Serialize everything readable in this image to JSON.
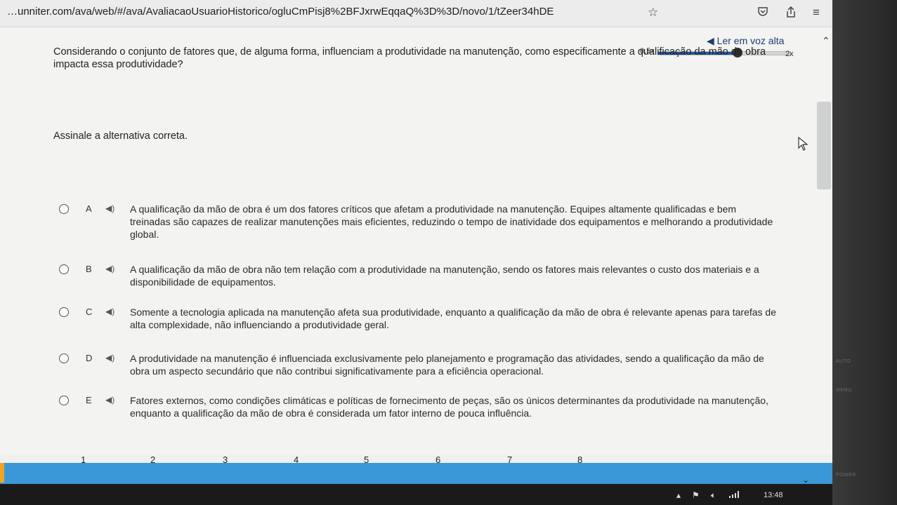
{
  "browser": {
    "url": "…unniter.com/ava/web/#/ava/AvaliacaoUsuarioHistorico/ogluCmPisj8%2BFJxrwEqqaQ%3D%3D/novo/1/tZeer34hDE",
    "star_icon": "star-icon",
    "pocket_icon": "pocket-icon",
    "share_icon": "share-icon",
    "menu_icon": "menu-icon"
  },
  "reader": {
    "label": "◀︎ Ler em voz alta",
    "speed_min": "0,5x",
    "speed_max": "2x",
    "speed_level": 0.6,
    "collapse_icon": "chevron-up-icon",
    "accent_color": "#1f5aa8"
  },
  "question": {
    "text": "Considerando o conjunto de fatores que, de alguma forma, influenciam a produtividade na manutenção, como especificamente a qualificação da mão de obra impacta essa produtividade?",
    "instruction": "Assinale a alternativa correta."
  },
  "options": [
    {
      "letter": "A",
      "text": "A qualificação da mão de obra é um dos fatores críticos que afetam a produtividade na manutenção. Equipes altamente qualificadas e bem treinadas são capazes de realizar manutenções mais eficientes, reduzindo o tempo de inatividade dos equipamentos e melhorando a produtividade global."
    },
    {
      "letter": "B",
      "text": "A qualificação da mão de obra não tem relação com a produtividade na manutenção, sendo os fatores mais relevantes o custo dos materiais e a disponibilidade de equipamentos."
    },
    {
      "letter": "C",
      "text": "Somente a tecnologia aplicada na manutenção afeta sua produtividade, enquanto a qualificação da mão de obra é relevante apenas para tarefas de alta complexidade, não influenciando a produtividade geral."
    },
    {
      "letter": "D",
      "text": "A produtividade na manutenção é influenciada exclusivamente pelo planejamento e programação das atividades, sendo a qualificação da mão de obra um aspecto secundário que não contribui significativamente para a eficiência operacional."
    },
    {
      "letter": "E",
      "text": "Fatores externos, como condições climáticas e políticas de fornecimento de peças, são os únicos determinantes da produtividade na manutenção, enquanto a qualificação da mão de obra é considerada um fator interno de pouca influência."
    }
  ],
  "pagination": {
    "pages": [
      "1",
      "2",
      "3",
      "4",
      "5",
      "6",
      "7",
      "8"
    ],
    "bar_color": "#3a98d6"
  },
  "taskbar": {
    "clock": "13:48"
  },
  "bezel": {
    "auto": "AUTO",
    "menu": "MENU",
    "power": "POWER"
  }
}
